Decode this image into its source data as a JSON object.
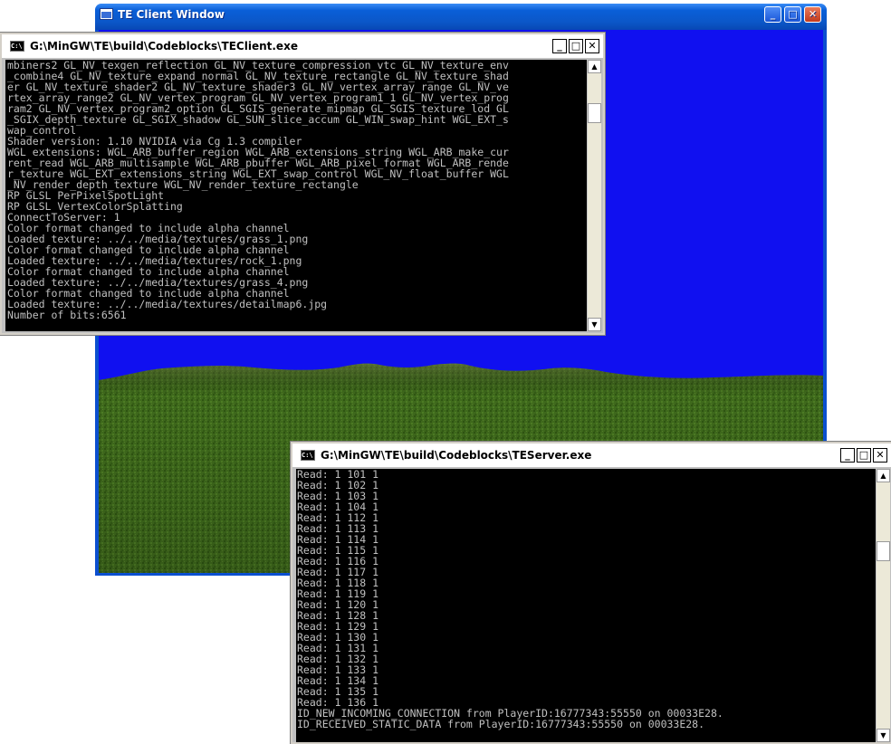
{
  "client_window": {
    "title": "TE Client Window",
    "colors": {
      "sky": "#1010f0",
      "terrain": "#3f6a1c",
      "mountain": "#6b7a3a"
    },
    "icon": "app-window-icon"
  },
  "client_console": {
    "title": "G:\\MinGW\\TE\\build\\Codeblocks\\TEClient.exe",
    "icon": "console-icon",
    "lines": [
      "mbiners2 GL_NV_texgen_reflection GL_NV_texture_compression_vtc GL_NV_texture_env",
      "_combine4 GL_NV_texture_expand_normal GL_NV_texture_rectangle GL_NV_texture_shad",
      "er GL_NV_texture_shader2 GL_NV_texture_shader3 GL_NV_vertex_array_range GL_NV_ve",
      "rtex_array_range2 GL_NV_vertex_program GL_NV_vertex_program1_1 GL_NV_vertex_prog",
      "ram2 GL_NV_vertex_program2_option GL_SGIS_generate_mipmap GL_SGIS_texture_lod GL",
      "_SGIX_depth_texture GL_SGIX_shadow GL_SUN_slice_accum GL_WIN_swap_hint WGL_EXT_s",
      "wap_control",
      "Shader version: 1.10 NVIDIA via Cg 1.3 compiler",
      "WGL extensions: WGL_ARB_buffer_region WGL_ARB_extensions_string WGL_ARB_make_cur",
      "rent_read WGL_ARB_multisample WGL_ARB_pbuffer WGL_ARB_pixel_format WGL_ARB_rende",
      "r_texture WGL_EXT_extensions_string WGL_EXT_swap_control WGL_NV_float_buffer WGL",
      "_NV_render_depth_texture WGL_NV_render_texture_rectangle",
      "RP GLSL PerPixelSpotLight",
      "RP GLSL VertexColorSplatting",
      "ConnectToServer: 1",
      "Color format changed to include alpha channel",
      "Loaded texture: ../../media/textures/grass_1.png",
      "Color format changed to include alpha channel",
      "Loaded texture: ../../media/textures/rock_1.png",
      "Color format changed to include alpha channel",
      "Loaded texture: ../../media/textures/grass_4.png",
      "Color format changed to include alpha channel",
      "Loaded texture: ../../media/textures/detailmap6.jpg",
      "Number of bits:6561"
    ]
  },
  "server_console": {
    "title": "G:\\MinGW\\TE\\build\\Codeblocks\\TEServer.exe",
    "icon": "console-icon",
    "lines": [
      "Read: 1 101 1",
      "Read: 1 102 1",
      "Read: 1 103 1",
      "Read: 1 104 1",
      "Read: 1 112 1",
      "Read: 1 113 1",
      "Read: 1 114 1",
      "Read: 1 115 1",
      "Read: 1 116 1",
      "Read: 1 117 1",
      "Read: 1 118 1",
      "Read: 1 119 1",
      "Read: 1 120 1",
      "Read: 1 128 1",
      "Read: 1 129 1",
      "Read: 1 130 1",
      "Read: 1 131 1",
      "Read: 1 132 1",
      "Read: 1 133 1",
      "Read: 1 134 1",
      "Read: 1 135 1",
      "Read: 1 136 1",
      "ID_NEW_INCOMING_CONNECTION from PlayerID:16777343:55550 on 00033E28.",
      "ID_RECEIVED_STATIC_DATA from PlayerID:16777343:55550 on 00033E28."
    ]
  },
  "buttons": {
    "minimize": "_",
    "maximize": "□",
    "close": "✕"
  }
}
